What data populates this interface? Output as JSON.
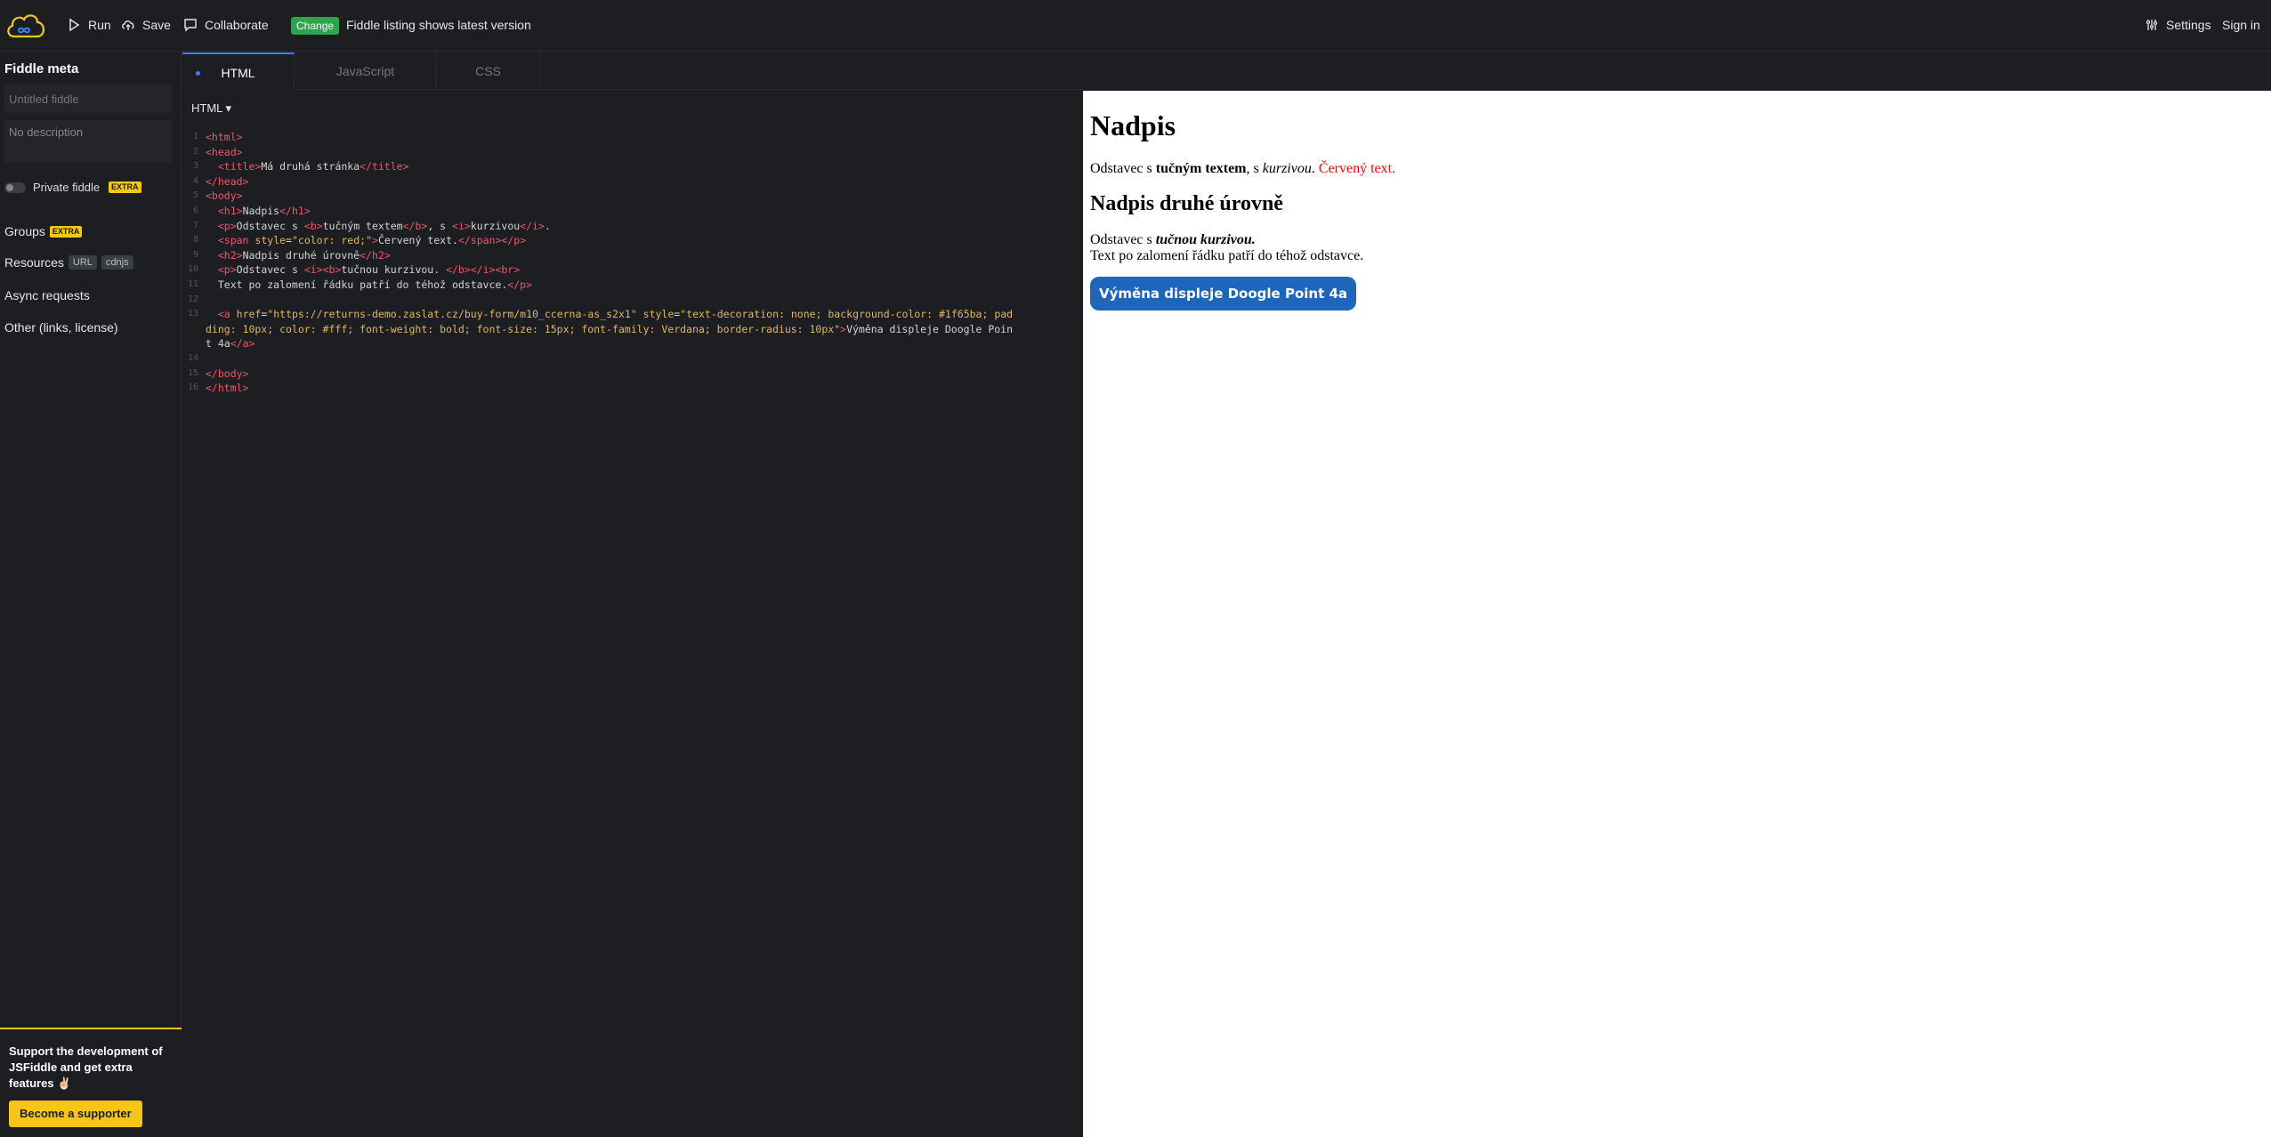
{
  "topbar": {
    "run_label": "Run",
    "save_label": "Save",
    "collaborate_label": "Collaborate",
    "change_badge": "Change",
    "change_text": "Fiddle listing shows latest version",
    "settings_label": "Settings",
    "signin_label": "Sign in"
  },
  "sidebar": {
    "title": "Fiddle meta",
    "title_placeholder": "Untitled fiddle",
    "description_placeholder": "No description",
    "private_label": "Private fiddle",
    "extra_badge": "EXTRA",
    "groups_label": "Groups",
    "resources_label": "Resources",
    "resources_url": "URL",
    "resources_cdnjs": "cdnjs",
    "async_label": "Async requests",
    "other_label": "Other (links, license)",
    "support_text": "Support the development of JSFiddle and get extra features ✌🏻",
    "support_button": "Become a supporter"
  },
  "editor": {
    "tabs": [
      {
        "label": "HTML"
      },
      {
        "label": "JavaScript"
      },
      {
        "label": "CSS"
      }
    ],
    "language_select": "HTML",
    "line_numbers": [
      "1",
      "2",
      "3",
      "4",
      "5",
      "6",
      "7",
      "8",
      "9",
      "10",
      "11",
      "12",
      "13",
      "",
      "",
      "14",
      "15",
      "16"
    ]
  },
  "preview": {
    "h1": "Nadpis",
    "p1_a": "Odstavec s ",
    "p1_bold": "tučným textem",
    "p1_b": ", s ",
    "p1_italic": "kurzivou",
    "p1_c": ". ",
    "p1_red": "Červený text.",
    "h2": "Nadpis druhé úrovně",
    "p2_a": "Odstavec s ",
    "p2_bi": "tučnou kurzivou.",
    "p2_line2": "Text po zalomení řádku patří do téhož odstavce.",
    "button_label": "Výměna displeje Doogle Point 4a"
  },
  "colors": {
    "accent_blue": "#3b82f6",
    "change_green": "#2ea44f",
    "extra_yellow": "#f5c518",
    "cta_blue": "#1f65ba"
  }
}
